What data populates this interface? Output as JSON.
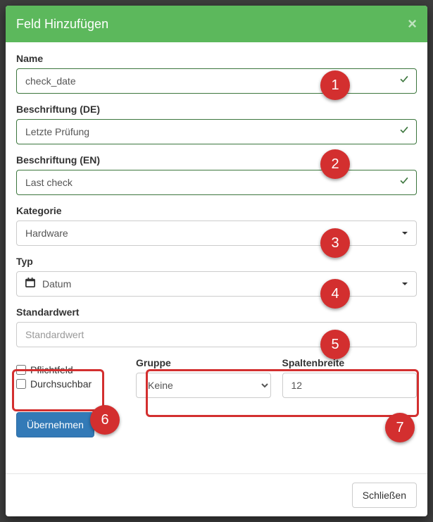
{
  "modal": {
    "title": "Feld Hinzufügen",
    "close_title": "Schließen"
  },
  "fields": {
    "name": {
      "label": "Name",
      "value": "check_date"
    },
    "label_de": {
      "label": "Beschriftung (DE)",
      "value": "Letzte Prüfung"
    },
    "label_en": {
      "label": "Beschriftung (EN)",
      "value": "Last check"
    },
    "category": {
      "label": "Kategorie",
      "value": "Hardware"
    },
    "type": {
      "label": "Typ",
      "value": "Datum"
    },
    "default": {
      "label": "Standardwert",
      "placeholder": "Standardwert"
    },
    "required": {
      "label": "Pflichtfeld"
    },
    "searchable": {
      "label": "Durchsuchbar"
    },
    "group": {
      "label": "Gruppe",
      "value": "Keine",
      "options": [
        "Keine"
      ]
    },
    "colwidth": {
      "label": "Spaltenbreite",
      "value": "12"
    }
  },
  "buttons": {
    "submit": "Übernehmen",
    "close": "Schließen"
  },
  "callouts": {
    "n1": "1",
    "n2": "2",
    "n3": "3",
    "n4": "4",
    "n5": "5",
    "n6": "6",
    "n7": "7"
  }
}
